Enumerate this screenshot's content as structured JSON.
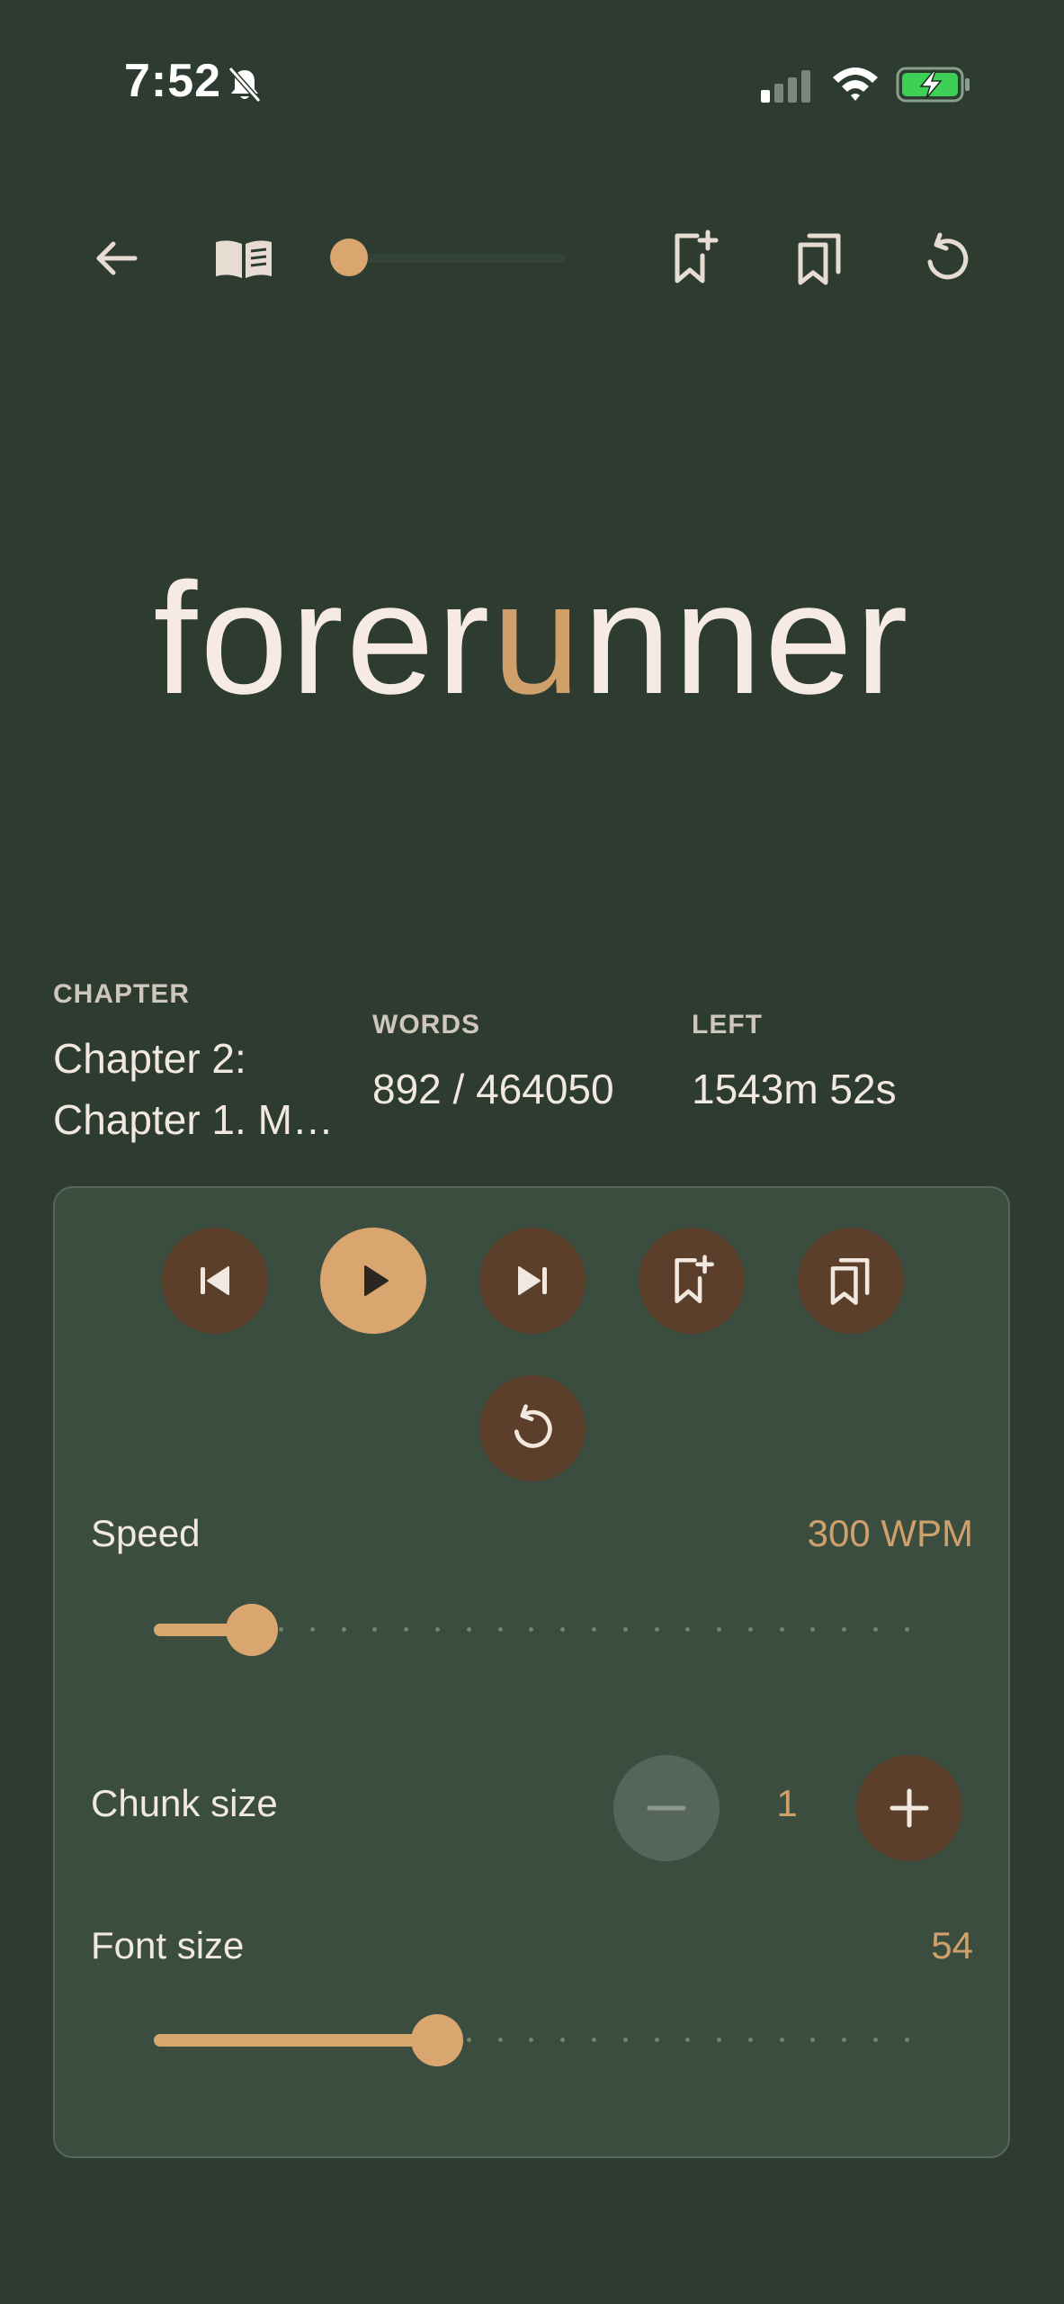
{
  "status_bar": {
    "time": "7:52"
  },
  "reader": {
    "word_before_focus": "forer",
    "word_focus_letter": "u",
    "word_after_focus": "nner",
    "progress_fraction": 0.002
  },
  "stats": {
    "chapter_label": "CHAPTER",
    "chapter_line1": "Chapter 2:",
    "chapter_line2": "Chapter 1. M…",
    "words_label": "WORDS",
    "words_value": "892 / 464050",
    "left_label": "LEFT",
    "left_value": "1543m 52s"
  },
  "controls": {
    "speed_label": "Speed",
    "speed_value": "300 WPM",
    "speed_fraction": 0.13,
    "chunk_label": "Chunk size",
    "chunk_value": "1",
    "font_label": "Font size",
    "font_value": "54",
    "font_fraction": 0.375
  },
  "colors": {
    "background": "#2d3b30",
    "panel": "#3b4d3f",
    "accent": "#d9a66f",
    "button_brown": "#5b3f2b",
    "text": "#f1e8df"
  },
  "icons": [
    "bell-slash-icon",
    "signal-icon",
    "wifi-icon",
    "battery-charging-icon",
    "back-arrow-icon",
    "book-open-icon",
    "bookmark-add-icon",
    "bookmarks-icon",
    "restart-icon",
    "skip-previous-icon",
    "play-icon",
    "skip-next-icon",
    "minus-icon",
    "plus-icon"
  ]
}
